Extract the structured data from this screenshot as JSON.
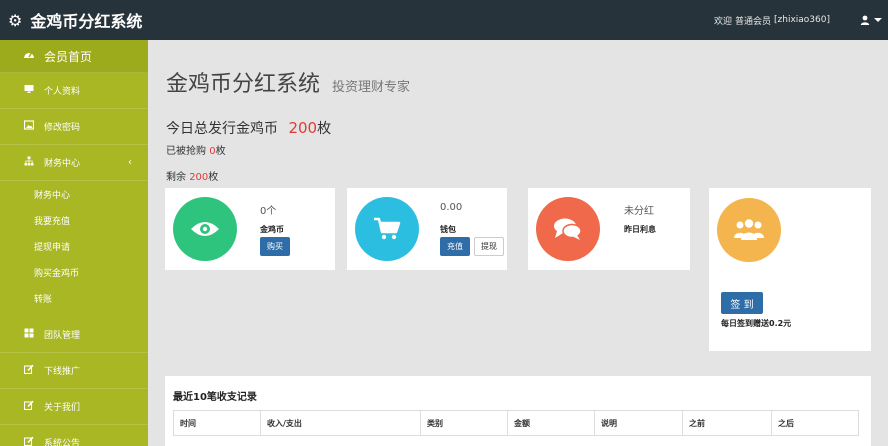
{
  "topbar": {
    "icon": "gear-icon",
    "title": "金鸡币分红系统",
    "welcome": "欢迎",
    "user_type": "普通会员",
    "username": "[zhixiao360]",
    "user_icon": "user-icon"
  },
  "sidebar": {
    "items": [
      {
        "label": "会员首页",
        "icon": "dashboard-icon"
      },
      {
        "label": "个人资料",
        "icon": "monitor-icon"
      },
      {
        "label": "修改密码",
        "icon": "image-icon"
      },
      {
        "label": "财务中心",
        "icon": "sitemap-icon"
      },
      {
        "label": "团队管理",
        "icon": "grid-icon"
      },
      {
        "label": "下线推广",
        "icon": "edit-icon"
      },
      {
        "label": "关于我们",
        "icon": "edit-icon"
      },
      {
        "label": "系统公告",
        "icon": "edit-icon"
      }
    ],
    "sub_items": [
      "财务中心",
      "我要充值",
      "提现申请",
      "购买金鸡币",
      "转账"
    ]
  },
  "main": {
    "title": "金鸡币分红系统",
    "subtitle": "投资理财专家",
    "issue_prefix": "今日总发行金鸡币",
    "issue_value": "200",
    "issue_unit": "枚",
    "bought_prefix": "已被抢购",
    "bought_value": "0",
    "bought_unit": "枚",
    "remain_prefix": "剩余",
    "remain_value": "200",
    "remain_unit": "枚"
  },
  "cards": [
    {
      "icon": "eye-icon",
      "color": "#2ec47e",
      "value": "0个",
      "label": "金鸡币",
      "btn1": "购买"
    },
    {
      "icon": "cart-icon",
      "color": "#2bbee0",
      "value": "0.00",
      "label": "钱包",
      "btn1": "充值",
      "btn2": "提现"
    },
    {
      "icon": "comments-icon",
      "color": "#f0694b",
      "value": "未分红",
      "label": "昨日利息"
    },
    {
      "icon": "users-icon",
      "color": "#f4b44e",
      "btn1": "签 到",
      "label": "每日签到赠送0.2元"
    }
  ],
  "records": {
    "title": "最近10笔收支记录",
    "columns": [
      "时间",
      "收入/支出",
      "类别",
      "金额",
      "说明",
      "之前",
      "之后"
    ]
  }
}
